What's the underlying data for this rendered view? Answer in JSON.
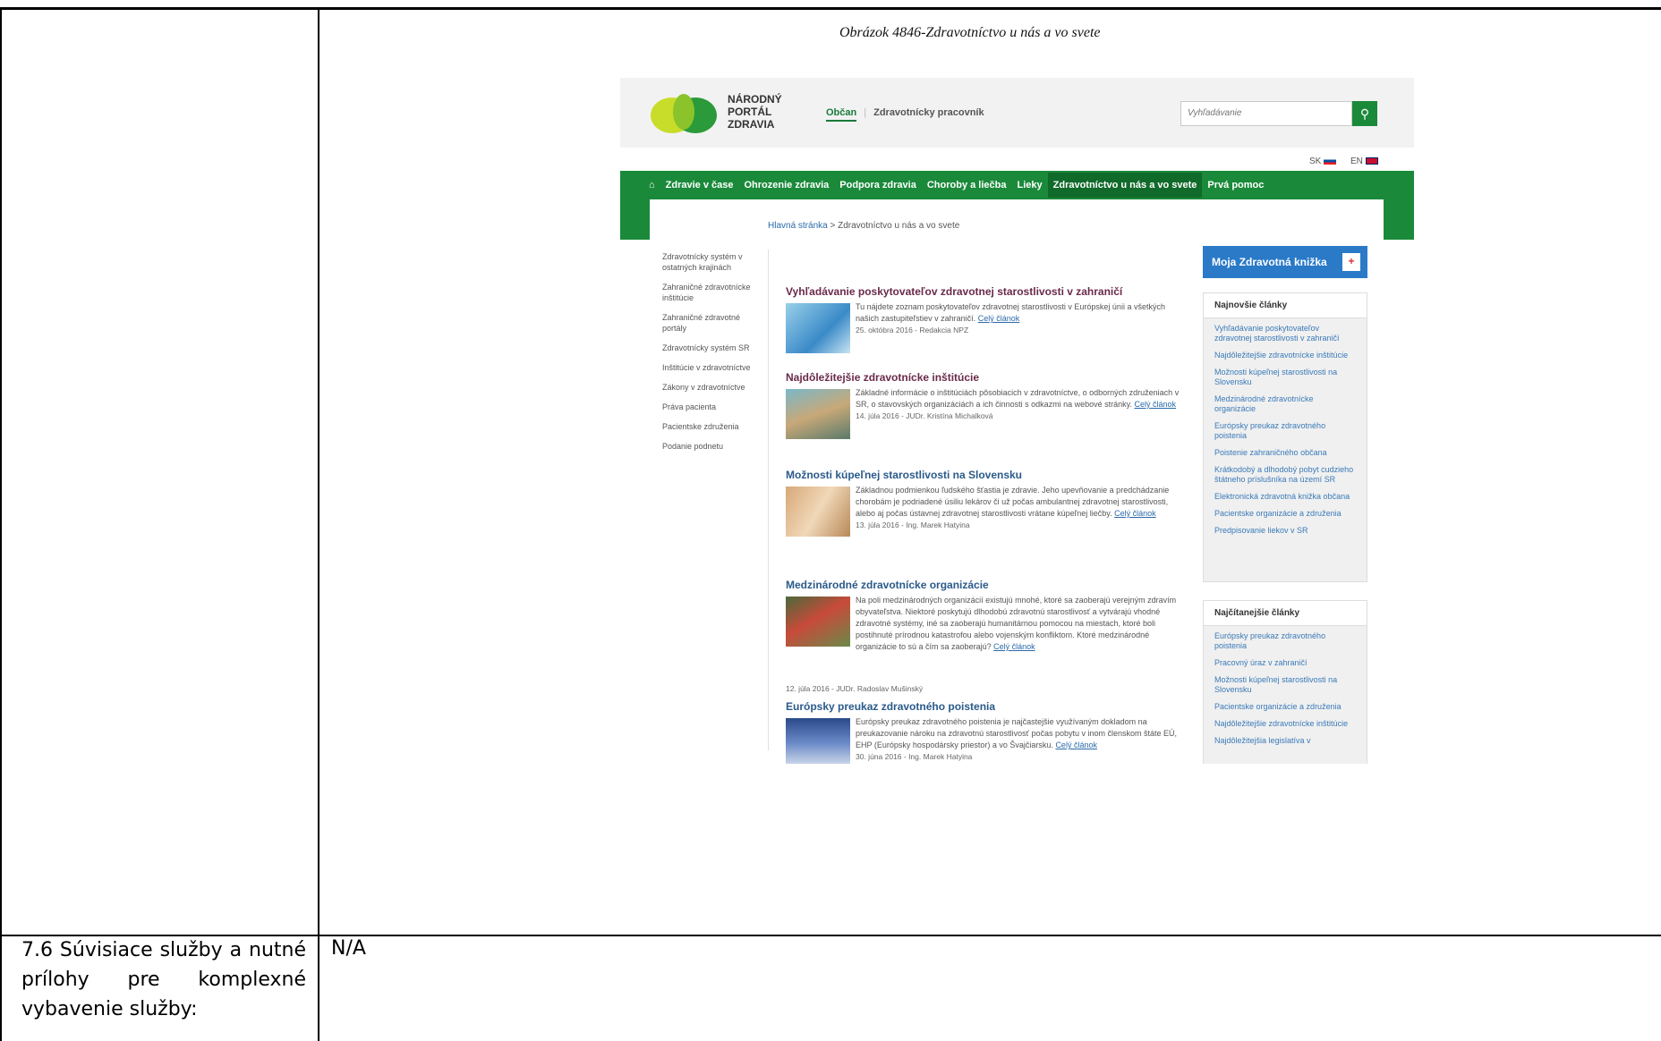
{
  "document": {
    "caption": "Obrázok 4846-Zdravotníctvo u nás a vo svete",
    "row2_label": "7.6 Súvisiace služby a nutné prílohy pre komplexné vybavenie služby:",
    "row2_label_lines": [
      "7.6 Súvisiace služby a nutné",
      "prílohy pre komplexné",
      "vybavenie služby:"
    ],
    "row2_value": "N/A"
  },
  "site": {
    "logo_lines": [
      "NÁRODNÝ",
      "PORTÁL",
      "ZDRAVIA"
    ],
    "audience_tabs": [
      "Občan",
      "Zdravotnícky pracovník"
    ],
    "search_placeholder": "Vyhľadávanie",
    "lang_sk": "SK",
    "lang_en": "EN",
    "nav": [
      "Zdravie v čase",
      "Ohrozenie zdravia",
      "Podpora zdravia",
      "Choroby a liečba",
      "Lieky",
      "Zdravotníctvo u nás a vo svete",
      "Prvá pomoc"
    ],
    "breadcrumb_home": "Hlavná stránka",
    "breadcrumb_sep": ">",
    "breadcrumb_current": "Zdravotníctvo u nás a vo svete",
    "leftnav": [
      "Zdravotnícky systém v ostatných krajinách",
      "Zahraničné zdravotnícke inštitúcie",
      "Zahraničné zdravotné portály",
      "Zdravotnícky systém SR",
      "Inštitúcie v zdravotníctve",
      "Zákony v zdravotníctve",
      "Práva pacienta",
      "Pacientske združenia",
      "Podanie podnetu"
    ],
    "more_link": "Celý článok",
    "articles": [
      {
        "title": "Vyhľadávanie poskytovateľov zdravotnej starostlivosti v zahraničí",
        "text": "Tu nájdete zoznam poskytovateľov zdravotnej starostlivosti v Európskej únii a všetkých našich zastupiteľstiev v zahraničí.",
        "meta": "25. októbra 2016 - Redakcia NPZ"
      },
      {
        "title": "Najdôležitejšie zdravotnícke inštitúcie",
        "text": "Základné informácie o inštitúciách pôsobiacich v zdravotníctve, o odborných združeniach v SR, o stavovských organizáciách a ich činnosti s odkazmi na webové stránky.",
        "meta": "14. júla 2016 - JUDr. Kristína Michalková"
      },
      {
        "title": "Možnosti kúpeľnej starostlivosti na Slovensku",
        "text": "Základnou podmienkou ľudského šťastia je zdravie. Jeho upevňovanie a predchádzanie chorobám je podriadené úsiliu lekárov či už počas ambulantnej zdravotnej starostlivosti, alebo aj počas ústavnej zdravotnej starostlivosti vrátane kúpeľnej liečby.",
        "meta": "13. júla 2016 - Ing. Marek Hatyina"
      },
      {
        "title": "Medzinárodné zdravotnícke organizácie",
        "text": "Na poli medzinárodných organizácií existujú mnohé, ktoré sa zaoberajú verejným zdravím obyvateľstva. Niektoré poskytujú dlhodobú zdravotnú starostlivosť a vytvárajú vhodné zdravotné systémy, iné sa zaoberajú humanitárnou pomocou na miestach, ktoré boli postihnuté prírodnou katastrofou alebo vojenským konfliktom. Ktoré medzinárodné organizácie to sú a čím sa zaoberajú?",
        "meta": "12. júla 2016 - JUDr. Radoslav Mušinský"
      },
      {
        "title": "Európsky preukaz zdravotného poistenia",
        "text": "Európsky preukaz zdravotného poistenia je najčastejšie využívaným dokladom na preukazovanie nároku na zdravotnú starostlivosť počas pobytu v inom členskom štáte EÚ, EHP (Európsky hospodársky priestor) a vo Švajčiarsku.",
        "meta": "30. júna 2016 - Ing. Marek Hatyina"
      }
    ],
    "moja_label": "Moja Zdravotná knižka",
    "box1_title": "Najnovšie články",
    "box1_items": [
      "Vyhľadávanie poskytovateľov zdravotnej starostlivosti v zahraničí",
      "Najdôležitejšie zdravotnícke inštitúcie",
      "Možnosti kúpeľnej starostlivosti na Slovensku",
      "Medzinárodné zdravotnícke organizácie",
      "Európsky preukaz zdravotného poistenia",
      "Poistenie zahraničného občana",
      "Krátkodobý a dlhodobý pobyt cudzieho štátneho príslušníka na území SR",
      "Elektronická zdravotná knižka občana",
      "Pacientske organizácie a združenia",
      "Predpisovanie liekov v SR"
    ],
    "box2_title": "Najčítanejšie články",
    "box2_items": [
      "Európsky preukaz zdravotného poistenia",
      "Pracovný úraz v zahraničí",
      "Možnosti kúpeľnej starostlivosti na Slovensku",
      "Pacientske organizácie a združenia",
      "Najdôležitejšie zdravotnícke inštitúcie",
      "Najdôležitejšia legislatíva v"
    ],
    "colors": {
      "green": "#1a8a3a",
      "blue": "#2a7ac8"
    }
  }
}
